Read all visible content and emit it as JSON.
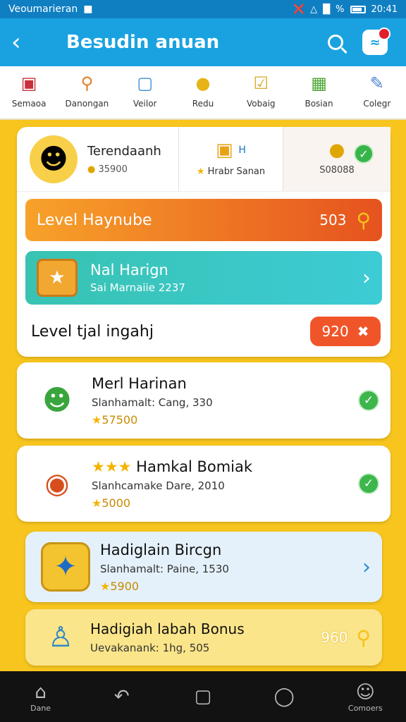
{
  "status": {
    "carrier": "Veoumarieran",
    "time": "20:41",
    "signal_pct": "%"
  },
  "appbar": {
    "back": "back-icon",
    "title": "Besudin anuan"
  },
  "categories": [
    {
      "label": "Semaoa",
      "icon": "gift-icon"
    },
    {
      "label": "Danongan",
      "icon": "magnifier-icon"
    },
    {
      "label": "Veilor",
      "icon": "bucket-icon"
    },
    {
      "label": "Redu",
      "icon": "coin-icon"
    },
    {
      "label": "Vobaig",
      "icon": "checklist-icon"
    },
    {
      "label": "Bosian",
      "icon": "crate-icon"
    },
    {
      "label": "Colegr",
      "icon": "clipboard-icon"
    }
  ],
  "profile": {
    "name": "Terendaanh",
    "coins": "35900",
    "middle_tag": "H",
    "middle_label": "Hrabr Sanan",
    "right_label": "S08088"
  },
  "level_bar": {
    "label": "Level Haynube",
    "value": "503"
  },
  "daily": {
    "title": "Nal Harign",
    "subtitle": "Sai Marnaiie 2237"
  },
  "level_row": {
    "label": "Level tjal ingahj",
    "value": "920"
  },
  "tasks": [
    {
      "title": "Merl Harinan",
      "sub": "Slanhamalt: Cang, 330",
      "reward": "57500"
    },
    {
      "title": "Hamkal Bomiak",
      "sub": "Slanhcamake Dare, 2010",
      "reward": "5000"
    },
    {
      "title": "Hadiglain Bircgn",
      "sub": "Slanhamalt: Paine, 1530",
      "reward": "5900"
    },
    {
      "title": "Hadigiah labah Bonus",
      "sub": "Uevakanank: 1hg, 505",
      "value": "960"
    }
  ],
  "bottom_nav": [
    {
      "label": "Dane",
      "icon": "home-icon"
    },
    {
      "label": "",
      "icon": "undo-icon"
    },
    {
      "label": "",
      "icon": "edit-icon"
    },
    {
      "label": "",
      "icon": "profile-icon"
    },
    {
      "label": "Comoers",
      "icon": "user-icon"
    }
  ]
}
